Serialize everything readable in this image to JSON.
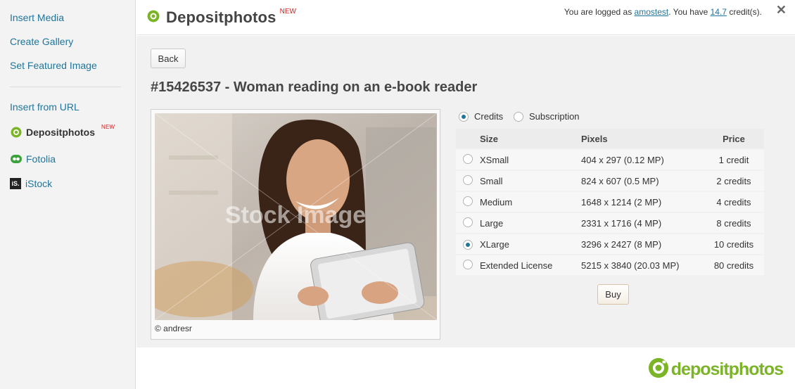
{
  "sidebar": {
    "links": [
      "Insert Media",
      "Create Gallery",
      "Set Featured Image",
      "Insert from URL"
    ],
    "services": [
      {
        "label": "Depositphotos",
        "badge": "NEW",
        "icon": "depositphotos-icon",
        "active": true
      },
      {
        "label": "Fotolia",
        "icon": "fotolia-icon"
      },
      {
        "label": "iStock",
        "icon": "istock-icon",
        "icon_text": "iS."
      }
    ]
  },
  "header": {
    "title": "Depositphotos",
    "badge": "NEW",
    "login_prefix": "You are logged as ",
    "username": "amostest",
    "login_mid": ". You have ",
    "credits": "14.7",
    "login_suffix": " credit(s).",
    "close": "✕"
  },
  "main": {
    "back_label": "Back",
    "title": "#15426537 - Woman reading on an e-book reader",
    "watermark": "Stock Image",
    "photo_credit": "© andresr",
    "license_options": [
      {
        "label": "Credits",
        "selected": true
      },
      {
        "label": "Subscription",
        "selected": false
      }
    ],
    "table": {
      "headers": [
        "Size",
        "Pixels",
        "Price"
      ],
      "rows": [
        {
          "size": "XSmall",
          "pixels": "404 x 297 (0.12 MP)",
          "price": "1 credit",
          "selected": false
        },
        {
          "size": "Small",
          "pixels": "824 x 607 (0.5 MP)",
          "price": "2 credits",
          "selected": false
        },
        {
          "size": "Medium",
          "pixels": "1648 x 1214 (2 MP)",
          "price": "4 credits",
          "selected": false
        },
        {
          "size": "Large",
          "pixels": "2331 x 1716 (4 MP)",
          "price": "8 credits",
          "selected": false
        },
        {
          "size": "XLarge",
          "pixels": "3296 x 2427 (8 MP)",
          "price": "10 credits",
          "selected": true
        },
        {
          "size": "Extended License",
          "pixels": "5215 x 3840 (20.03 MP)",
          "price": "80 credits",
          "selected": false
        }
      ]
    },
    "buy_label": "Buy"
  },
  "footer": {
    "logo_text": "depositphotos"
  },
  "colors": {
    "link": "#21759b",
    "brand_green": "#7cb428",
    "new_badge": "#d12121"
  }
}
